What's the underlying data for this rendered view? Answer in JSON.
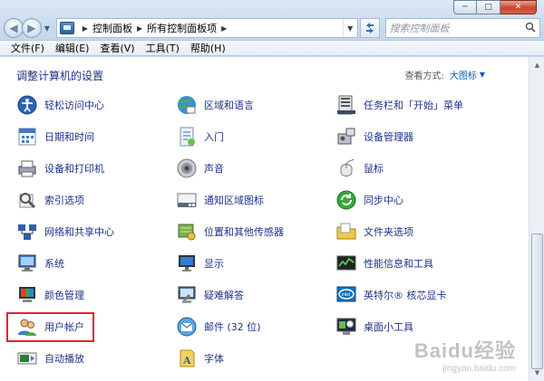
{
  "window": {
    "minimize_glyph": "─",
    "maximize_glyph": "□",
    "close_glyph": "✕"
  },
  "nav": {
    "back_glyph": "◀",
    "forward_glyph": "▶",
    "breadcrumb": [
      "控制面板",
      "所有控制面板项"
    ],
    "search_placeholder": "搜索控制面板"
  },
  "menubar": [
    "文件(F)",
    "编辑(E)",
    "查看(V)",
    "工具(T)",
    "帮助(H)"
  ],
  "content": {
    "heading": "调整计算机的设置",
    "view_by_label": "查看方式:",
    "view_by_value": "大图标"
  },
  "items": [
    {
      "label": "轻松访问中心",
      "icon": "ease-of-access-icon"
    },
    {
      "label": "区域和语言",
      "icon": "region-language-icon"
    },
    {
      "label": "任务栏和「开始」菜单",
      "icon": "taskbar-start-menu-icon"
    },
    {
      "label": "日期和时间",
      "icon": "date-time-icon"
    },
    {
      "label": "入门",
      "icon": "getting-started-icon"
    },
    {
      "label": "设备管理器",
      "icon": "device-manager-icon"
    },
    {
      "label": "设备和打印机",
      "icon": "devices-printers-icon"
    },
    {
      "label": "声音",
      "icon": "sound-icon"
    },
    {
      "label": "鼠标",
      "icon": "mouse-icon"
    },
    {
      "label": "索引选项",
      "icon": "indexing-options-icon"
    },
    {
      "label": "通知区域图标",
      "icon": "notification-area-icon"
    },
    {
      "label": "同步中心",
      "icon": "sync-center-icon"
    },
    {
      "label": "网络和共享中心",
      "icon": "network-sharing-icon"
    },
    {
      "label": "位置和其他传感器",
      "icon": "location-sensors-icon"
    },
    {
      "label": "文件夹选项",
      "icon": "folder-options-icon"
    },
    {
      "label": "系统",
      "icon": "system-icon"
    },
    {
      "label": "显示",
      "icon": "display-icon"
    },
    {
      "label": "性能信息和工具",
      "icon": "performance-icon"
    },
    {
      "label": "颜色管理",
      "icon": "color-management-icon"
    },
    {
      "label": "疑难解答",
      "icon": "troubleshooting-icon"
    },
    {
      "label": "英特尔® 核芯显卡",
      "icon": "intel-graphics-icon"
    },
    {
      "label": "用户帐户",
      "icon": "user-accounts-icon"
    },
    {
      "label": "邮件 (32 位)",
      "icon": "mail-icon"
    },
    {
      "label": "桌面小工具",
      "icon": "desktop-gadgets-icon"
    },
    {
      "label": "自动播放",
      "icon": "autoplay-icon"
    },
    {
      "label": "字体",
      "icon": "fonts-icon"
    }
  ],
  "highlighted_item": "用户帐户",
  "watermark": {
    "logo": "Baidu经验",
    "url": "jingyan.baidu.com"
  },
  "colors": {
    "link_text": "#1e3287",
    "highlight_border": "#e2242b",
    "view_value": "#0b5fb0"
  }
}
